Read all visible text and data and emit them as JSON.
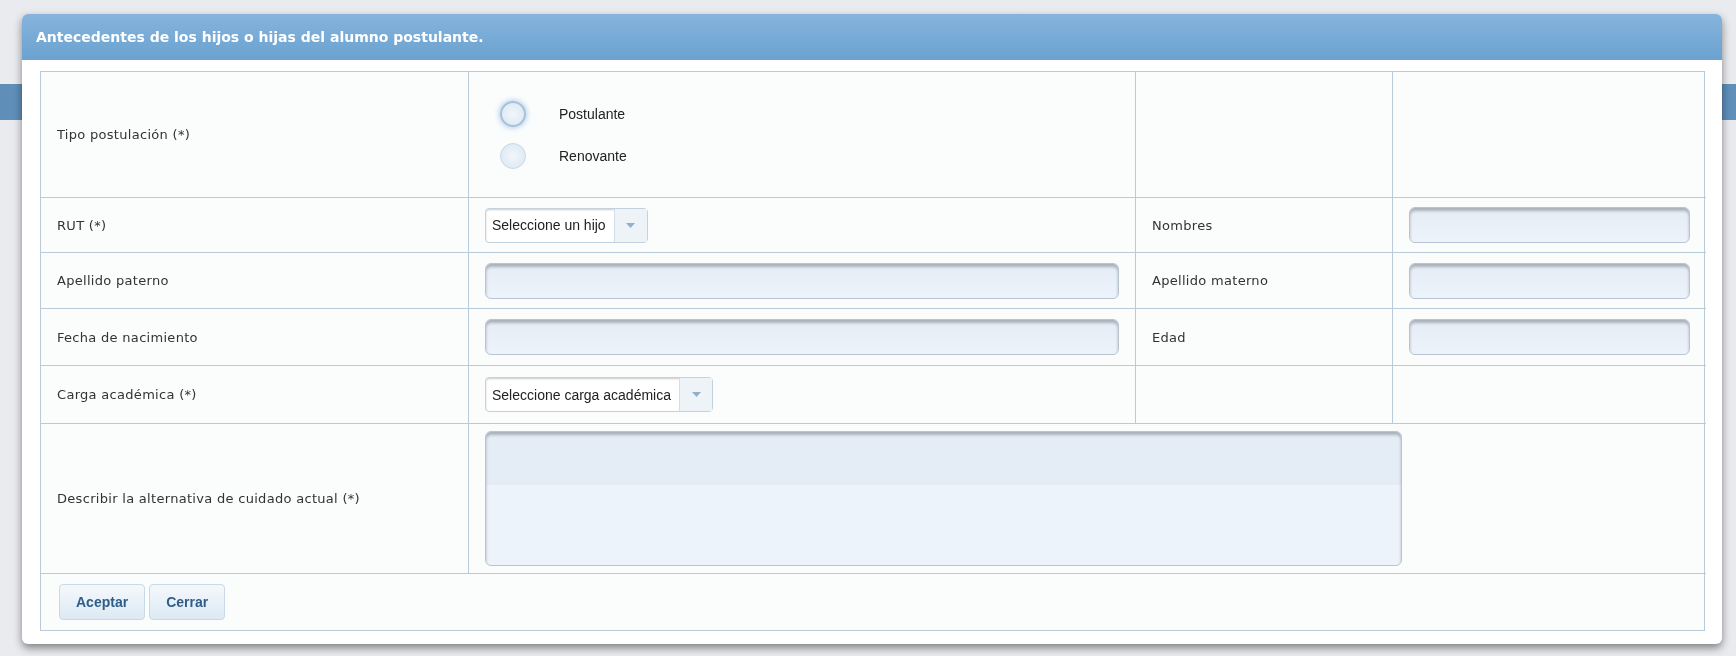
{
  "dialog": {
    "title": "Antecedentes de los hijos o hijas del alumno postulante.",
    "rows": [
      {
        "cells": [
          {
            "kind": "label",
            "text": "Tipo postulación (*)"
          },
          {
            "kind": "radio",
            "options": [
              {
                "label": "Postulante",
                "selected": false,
                "focused": true
              },
              {
                "label": "Renovante",
                "selected": false,
                "focused": false
              }
            ]
          },
          {
            "kind": "blank"
          },
          {
            "kind": "blank"
          }
        ]
      },
      {
        "cells": [
          {
            "kind": "label",
            "text": "RUT (*)"
          },
          {
            "kind": "select",
            "value": "Seleccione un hijo"
          },
          {
            "kind": "label",
            "text": "Nombres"
          },
          {
            "kind": "text"
          }
        ]
      },
      {
        "cells": [
          {
            "kind": "label",
            "text": "Apellido paterno"
          },
          {
            "kind": "text"
          },
          {
            "kind": "label",
            "text": "Apellido materno"
          },
          {
            "kind": "text"
          }
        ]
      },
      {
        "cells": [
          {
            "kind": "label",
            "text": "Fecha de nacimiento"
          },
          {
            "kind": "text"
          },
          {
            "kind": "label",
            "text": "Edad"
          },
          {
            "kind": "text"
          }
        ]
      },
      {
        "cells": [
          {
            "kind": "label",
            "text": "Carga académica (*)"
          },
          {
            "kind": "select",
            "value": "Seleccione carga académica"
          },
          {
            "kind": "blank"
          },
          {
            "kind": "blank"
          }
        ]
      },
      {
        "cells": [
          {
            "kind": "label",
            "text": "Describir la alternativa de cuidado actual (*)"
          },
          {
            "kind": "textarea"
          }
        ]
      }
    ],
    "buttons": [
      "Aceptar",
      "Cerrar"
    ]
  }
}
